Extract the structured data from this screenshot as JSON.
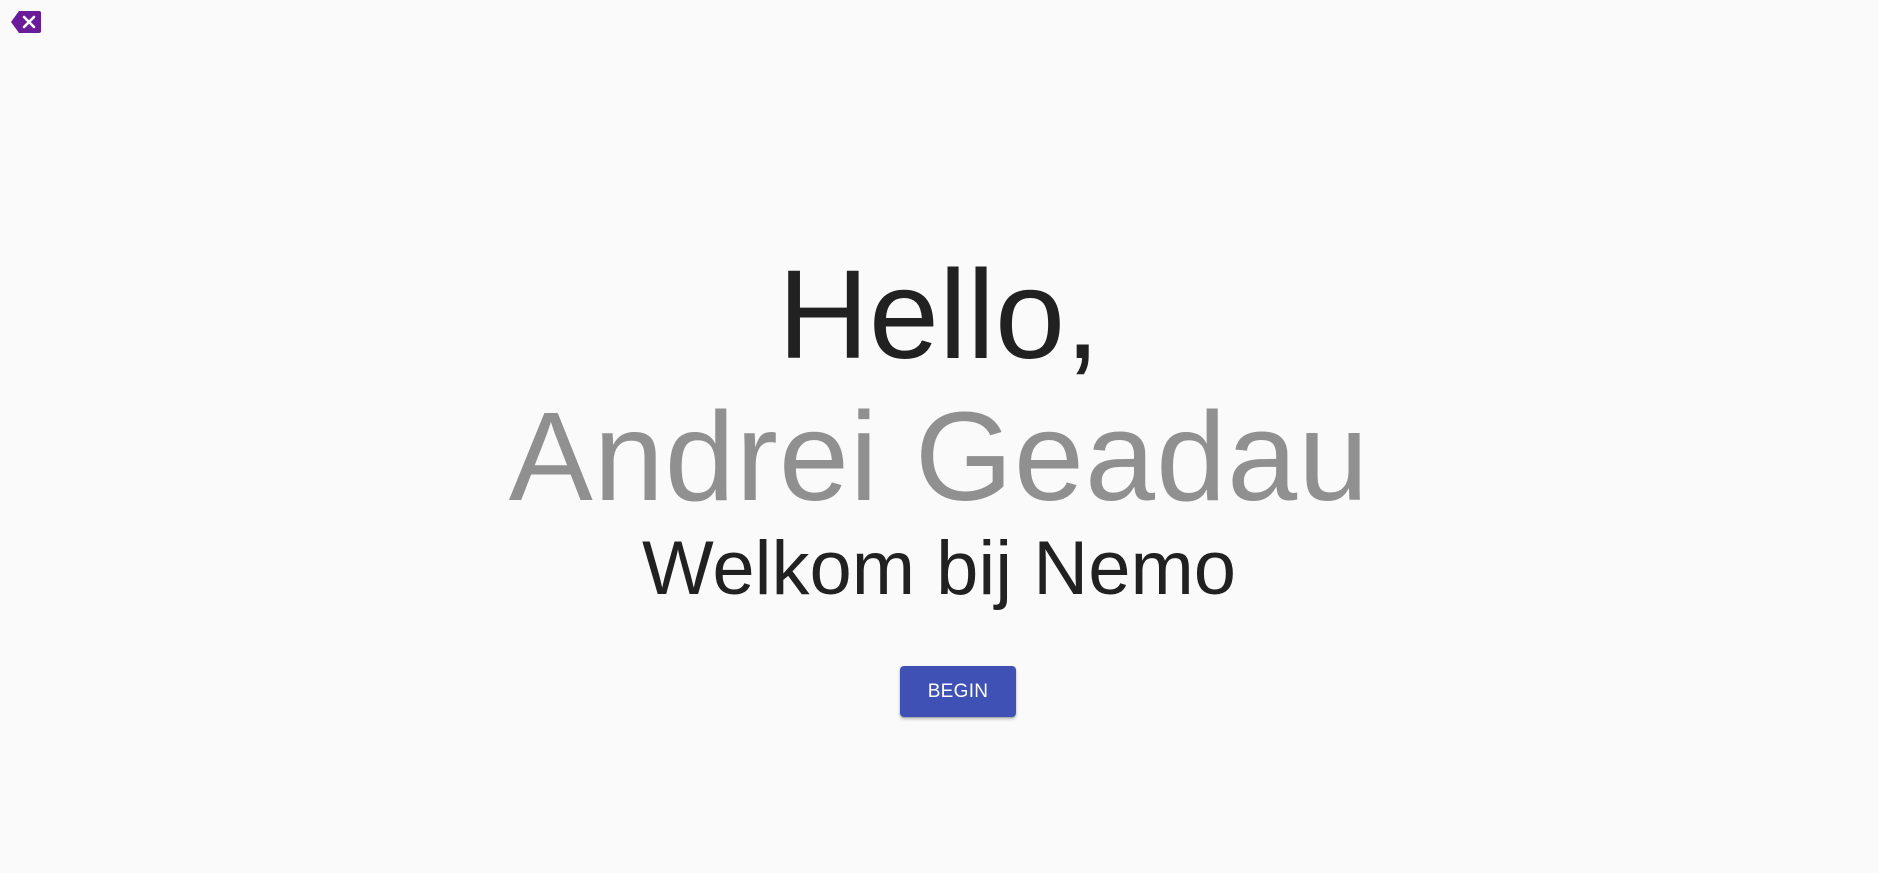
{
  "exit": {
    "icon": "backspace-close-icon",
    "color": "#6a1b9a"
  },
  "greeting": {
    "hello": "Hello,",
    "user_name": "Andrei Geadau",
    "welcome": "Welkom bij Nemo"
  },
  "actions": {
    "begin_label": "BEGIN",
    "begin_color": "#3f51b5"
  }
}
